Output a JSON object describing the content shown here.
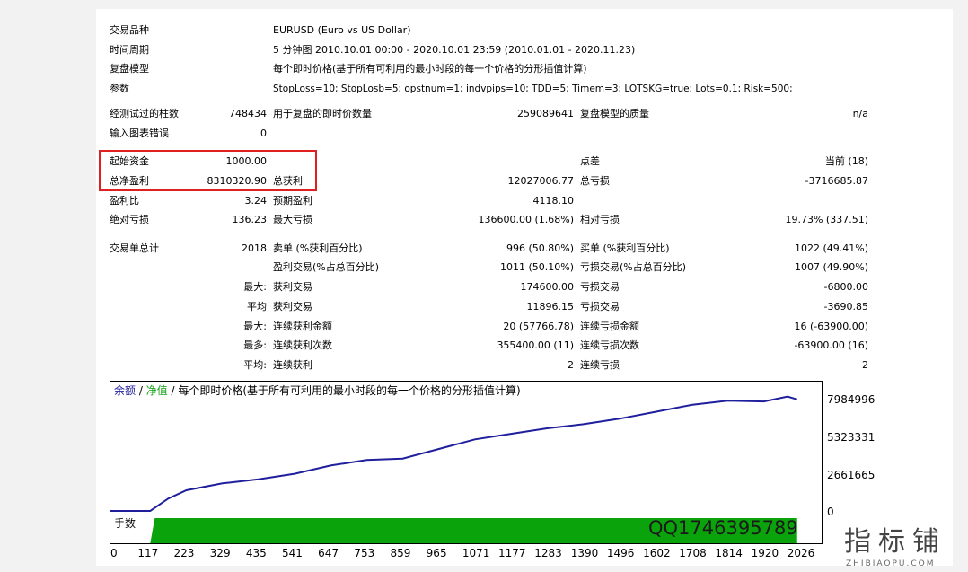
{
  "settings": {
    "symbol": {
      "label": "交易品种",
      "value": "EURUSD (Euro vs US Dollar)"
    },
    "period": {
      "label": "时间周期",
      "value": "5 分钟图 2010.10.01 00:00 - 2020.10.01 23:59 (2010.01.01 - 2020.11.23)"
    },
    "model": {
      "label": "复盘模型",
      "value": "每个即时价格(基于所有可利用的最小时段的每一个价格的分形插值计算)"
    },
    "params": {
      "label": "参数",
      "value": "StopLoss=10; StopLosb=5; opstnum=1; indvpips=10; TDD=5; Timem=3; LOTSKG=true; Lots=0.1; Risk=500;"
    }
  },
  "bars_info": {
    "bars_label": "经测试过的柱数",
    "bars_value": "748434",
    "ticks_label": "用于复盘的即时价数量",
    "ticks_value": "259089641",
    "quality_label": "复盘模型的质量",
    "quality_value": "n/a",
    "errors_label": "输入图表错误",
    "errors_value": "0"
  },
  "stats": {
    "deposit_label": "起始资金",
    "deposit_value": "1000.00",
    "spread_label": "点差",
    "spread_value": "当前 (18)",
    "netprofit_label": "总净盈利",
    "netprofit_value": "8310320.90",
    "grossprofit_label": "总获利",
    "grossprofit_value": "12027006.77",
    "grossloss_label": "总亏损",
    "grossloss_value": "-3716685.87",
    "pf_label": "盈利比",
    "pf_value": "3.24",
    "expected_label": "预期盈利",
    "expected_value": "4118.10",
    "absdd_label": "绝对亏损",
    "absdd_value": "136.23",
    "maxdd_label": "最大亏损",
    "maxdd_value": "136600.00 (1.68%)",
    "reldd_label": "相对亏损",
    "reldd_value": "19.73% (337.51)"
  },
  "trades": {
    "total_label": "交易单总计",
    "total_value": "2018",
    "short_label": "卖单 (%获利百分比)",
    "short_value": "996 (50.80%)",
    "long_label": "买单 (%获利百分比)",
    "long_value": "1022 (49.41%)",
    "profit_label": "盈利交易(%占总百分比)",
    "profit_value": "1011 (50.10%)",
    "loss_label": "亏损交易(%占总百分比)",
    "loss_value": "1007 (49.90%)",
    "max_label": "最大:",
    "max_profit_label": "获利交易",
    "max_profit_value": "174600.00",
    "max_loss_label": "亏损交易",
    "max_loss_value": "-6800.00",
    "avg_label": "平均",
    "avg_profit_label": "获利交易",
    "avg_profit_value": "11896.15",
    "avg_loss_label": "亏损交易",
    "avg_loss_value": "-3690.85",
    "maxcons_label": "最大:",
    "maxcons_win_label": "连续获利金额",
    "maxcons_win_value": "20 (57766.78)",
    "maxcons_loss_label": "连续亏损金额",
    "maxcons_loss_value": "16 (-63900.00)",
    "mostcons_label": "最多:",
    "mostcons_win_label": "连续获利次数",
    "mostcons_win_value": "355400.00 (11)",
    "mostcons_loss_label": "连续亏损次数",
    "mostcons_loss_value": "-63900.00 (16)",
    "avgcons_label": "平均:",
    "avgcons_win_label": "连续获利",
    "avgcons_win_value": "2",
    "avgcons_loss_label": "连续亏损",
    "avgcons_loss_value": "2"
  },
  "chart": {
    "legend_balance": "余额",
    "legend_sep1": " / ",
    "legend_equity": "净值",
    "legend_sep2": " / ",
    "legend_model": "每个即时价格(基于所有可利用的最小时段的每一个价格的分形插值计算)",
    "lots_label": "手数",
    "watermark": "QQ1746395789",
    "colors": {
      "balance": "#1f1f9e",
      "equity": "#14a014",
      "lots": "#0ba30b",
      "highlight": "#e02020"
    }
  },
  "chart_data": {
    "type": "line",
    "ylim": [
      0,
      9000000
    ],
    "y_ticks": [
      "7984996",
      "5323331",
      "2661665",
      "0"
    ],
    "x_ticks": [
      "0",
      "117",
      "223",
      "329",
      "435",
      "541",
      "647",
      "753",
      "859",
      "965",
      "1071",
      "1177",
      "1283",
      "1390",
      "1496",
      "1602",
      "1708",
      "1814",
      "1920",
      "2026"
    ],
    "series": [
      {
        "name": "余额",
        "x": [
          0,
          117,
          170,
          223,
          329,
          435,
          541,
          647,
          753,
          859,
          965,
          1071,
          1177,
          1283,
          1390,
          1496,
          1602,
          1708,
          1814,
          1920,
          1990,
          2018
        ],
        "values": [
          1000,
          1000,
          900000,
          1500000,
          2000000,
          2300000,
          2700000,
          3300000,
          3700000,
          3800000,
          4500000,
          5200000,
          5600000,
          6000000,
          6300000,
          6700000,
          7200000,
          7700000,
          8000000,
          7950000,
          8300000,
          8100000
        ]
      }
    ]
  },
  "site": {
    "logo": "指标铺",
    "domain": "ZHIBIAOPU.COM"
  }
}
